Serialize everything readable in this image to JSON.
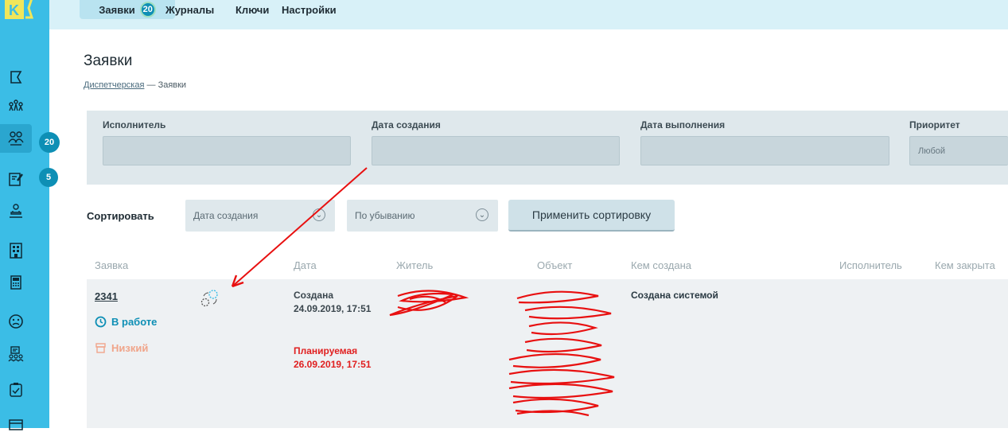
{
  "logo": {
    "letter": "K",
    "color": "#3bbde6"
  },
  "sidebar": {
    "badges": {
      "requests": "20",
      "journals": "5"
    },
    "icons": [
      "flag-icon",
      "chart-icon",
      "residents-icon",
      "edit-icon",
      "dispatcher-icon",
      "building-icon",
      "calculator-icon",
      "sad-face-icon",
      "group-icon",
      "checklist-icon",
      "card-icon"
    ]
  },
  "topnav": {
    "tabs": [
      {
        "label": "Заявки",
        "badge": "20",
        "active": true
      },
      {
        "label": "Журналы"
      },
      {
        "label": "Ключи"
      },
      {
        "label": "Настройки"
      }
    ]
  },
  "page": {
    "title": "Заявки",
    "breadcrumb": {
      "link": "Диспетчерская",
      "separator": " — ",
      "current": "Заявки"
    }
  },
  "filters": {
    "executor_label": "Исполнитель",
    "created_label": "Дата создания",
    "done_label": "Дата выполнения",
    "priority_label": "Приоритет",
    "priority_value": "Любой"
  },
  "sort": {
    "label": "Сортировать",
    "field": "Дата создания",
    "order": "По убыванию",
    "apply": "Применить сортировку"
  },
  "table": {
    "headers": [
      "Заявка",
      "Дата",
      "Житель",
      "Объект",
      "Кем создана",
      "Исполнитель",
      "Кем закрыта"
    ],
    "rows": [
      {
        "number": "2341",
        "status": "В работе",
        "priority": "Низкий",
        "created": "Создана 24.09.2019, 17:51",
        "planned": "Планируемая 26.09.2019, 17:51",
        "created_by": "Создана системой"
      }
    ]
  },
  "colors": {
    "accent": "#3bbde6",
    "status": "#0e8fb5",
    "priority_low": "#f0a58a",
    "planned": "#e02020"
  }
}
